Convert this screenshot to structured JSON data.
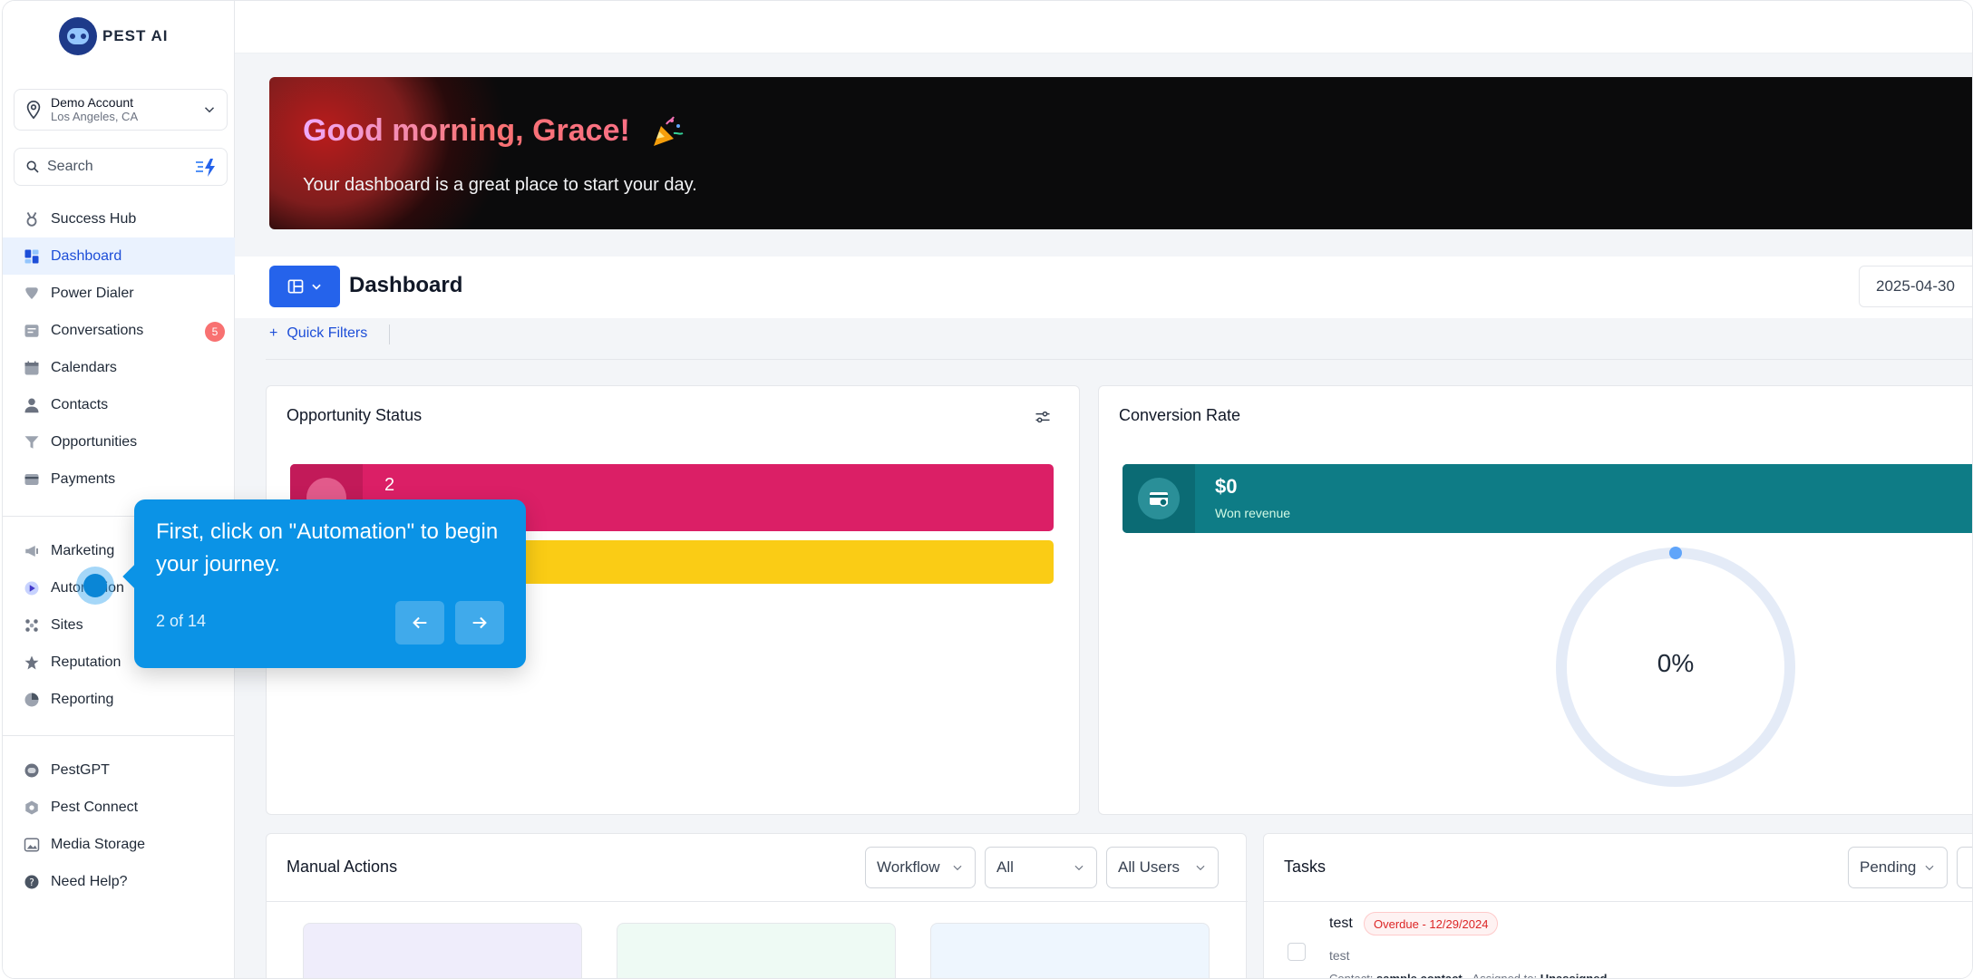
{
  "brand": {
    "name": "PEST AI"
  },
  "account": {
    "name": "Demo Account",
    "location": "Los Angeles, CA"
  },
  "search": {
    "placeholder": "Search"
  },
  "nav_primary": [
    {
      "label": "Success Hub",
      "icon": "medal-icon"
    },
    {
      "label": "Dashboard",
      "icon": "grid-icon",
      "active": true
    },
    {
      "label": "Power Dialer",
      "icon": "heart-icon"
    },
    {
      "label": "Conversations",
      "icon": "chat-icon",
      "badge": "5"
    },
    {
      "label": "Calendars",
      "icon": "calendar-icon"
    },
    {
      "label": "Contacts",
      "icon": "person-icon"
    },
    {
      "label": "Opportunities",
      "icon": "funnel-icon"
    },
    {
      "label": "Payments",
      "icon": "card-icon"
    }
  ],
  "nav_secondary": [
    {
      "label": "Marketing",
      "icon": "megaphone-icon"
    },
    {
      "label": "Automation",
      "icon": "play-icon"
    },
    {
      "label": "Sites",
      "icon": "globe-icon"
    },
    {
      "label": "Reputation",
      "icon": "star-icon"
    },
    {
      "label": "Reporting",
      "icon": "pie-icon"
    }
  ],
  "nav_tertiary": [
    {
      "label": "PestGPT",
      "icon": "bot-icon"
    },
    {
      "label": "Pest Connect",
      "icon": "hex-icon"
    },
    {
      "label": "Media Storage",
      "icon": "image-icon"
    },
    {
      "label": "Need Help?",
      "icon": "help-icon"
    }
  ],
  "hero": {
    "title": "Good morning, Grace!",
    "emoji_icon": "party-popper-icon",
    "subtitle": "Your dashboard is a great place to start your day."
  },
  "dashboard": {
    "title": "Dashboard",
    "date": "2025-04-30",
    "quick_filters": "Quick Filters"
  },
  "opportunity": {
    "title": "Opportunity Status",
    "pink_value": "2"
  },
  "conversion": {
    "title": "Conversion Rate",
    "won_value": "$0",
    "won_label": "Won revenue",
    "rate": "0%",
    "rate_fraction": 0
  },
  "manual": {
    "title": "Manual Actions",
    "filters": [
      "Workflow",
      "All",
      "All Users"
    ]
  },
  "tasks": {
    "title": "Tasks",
    "filter": "Pending",
    "item": {
      "name": "test",
      "status": "Overdue - 12/29/2024",
      "sub": "test",
      "contact_label": "Contact:",
      "contact": "sample contact",
      "assigned_label": "Assigned to:",
      "assigned": "Unassigned"
    }
  },
  "tour": {
    "text": "First, click on \"Automation\" to begin your journey.",
    "step": "2 of 14"
  },
  "colors": {
    "primary": "#2563eb",
    "pink": "#db1f66",
    "yellow": "#facc15",
    "teal": "#0e7c86",
    "tooltip": "#0b93e6"
  }
}
